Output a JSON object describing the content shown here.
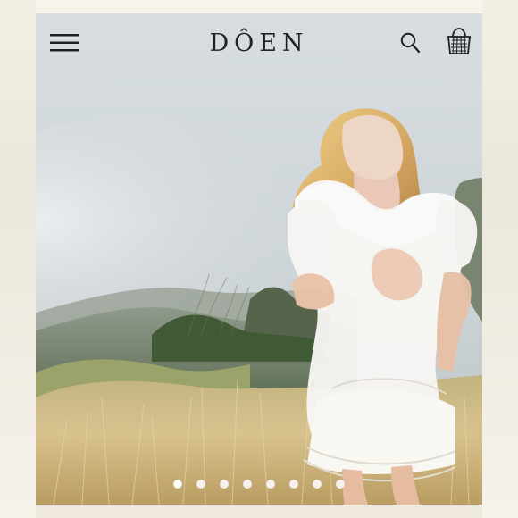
{
  "header": {
    "brand": "DÔEN",
    "menu_icon": "hamburger-menu-icon",
    "search_icon": "search-icon",
    "cart_icon": "shopping-basket-icon"
  },
  "carousel": {
    "slide_count": 8,
    "active_index": 0
  },
  "colors": {
    "sky_top": "#d7dde1",
    "sky_bottom": "#c8ced1",
    "grass": "#cdb77d",
    "dress": "#f8f7f4",
    "hair": "#d8ab64"
  }
}
